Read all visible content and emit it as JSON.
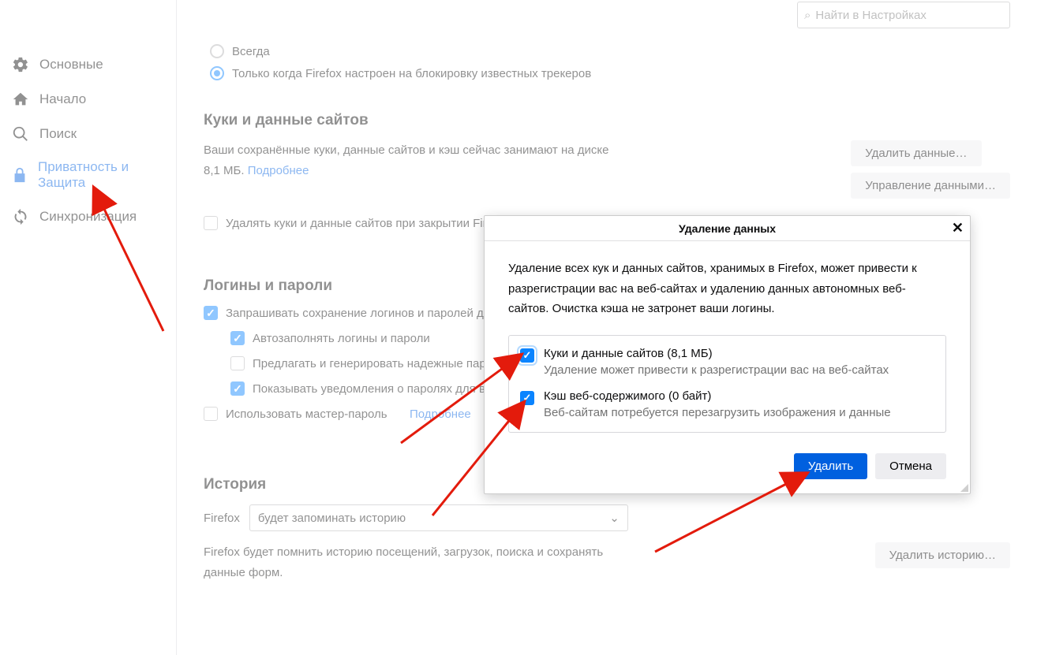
{
  "search": {
    "placeholder": "Найти в Настройках"
  },
  "sidebar": {
    "items": [
      {
        "label": "Основные"
      },
      {
        "label": "Начало"
      },
      {
        "label": "Поиск"
      },
      {
        "label": "Приватность и Защита"
      },
      {
        "label": "Синхронизация"
      }
    ]
  },
  "tracking": {
    "opt_always": "Всегда",
    "opt_only": "Только когда Firefox настроен на блокировку известных трекеров"
  },
  "cookies": {
    "heading": "Куки и данные сайтов",
    "desc_a": "Ваши сохранённые куки, данные сайтов и кэш сейчас занимают на диске 8,1 МБ.   ",
    "learn_more": "Подробнее",
    "btn_clear": "Удалить данные…",
    "btn_manage": "Управление данными…",
    "chk_clear_on_close": "Удалять куки и данные сайтов при закрытии Firefox"
  },
  "logins": {
    "heading": "Логины и пароли",
    "chk_ask": "Запрашивать сохранение логинов и паролей для веб-сайтов",
    "chk_autofill": "Автозаполнять логины и пароли",
    "chk_generate": "Предлагать и генерировать надежные пароли",
    "chk_breach": "Показывать уведомления о паролях для взломанных сайтов",
    "chk_master": "Использовать мастер-пароль",
    "learn_more": "Подробнее"
  },
  "history": {
    "heading": "История",
    "label": "Firefox",
    "select_value": "будет запоминать историю",
    "desc": "Firefox будет помнить историю посещений, загрузок, поиска и сохранять данные форм.",
    "btn_clear": "Удалить историю…"
  },
  "dialog": {
    "title": "Удаление данных",
    "text": "Удаление всех кук и данных сайтов, хранимых в Firefox, может привести к разрегистрации вас на веб-сайтах и удалению данных автономных веб-сайтов. Очистка кэша не затронет ваши логины.",
    "opt1_label": "Куки и данные сайтов (8,1 МБ)",
    "opt1_sub": "Удаление может привести к разрегистрации вас на веб-сайтах",
    "opt2_label": "Кэш веб-содержимого (0 байт)",
    "opt2_sub": "Веб-сайтам потребуется перезагрузить изображения и данные",
    "btn_delete": "Удалить",
    "btn_cancel": "Отмена"
  }
}
